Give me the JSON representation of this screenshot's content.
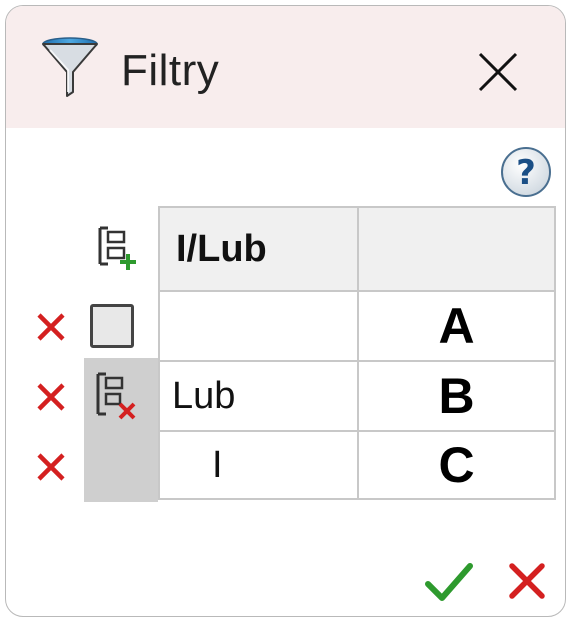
{
  "window": {
    "title": "Filtry"
  },
  "table": {
    "header": [
      "I/Lub",
      ""
    ],
    "rows": [
      {
        "cell": "",
        "label": "A"
      },
      {
        "cell": "Lub",
        "label": "B"
      },
      {
        "cell": "I",
        "label": "C"
      }
    ]
  },
  "icons": {
    "title": "funnel-icon",
    "close": "close-icon",
    "help": "help-icon",
    "add_group": "add-group-icon",
    "remove_group": "remove-group-icon",
    "delete_row": "delete-row-icon",
    "ok": "checkmark-icon",
    "cancel": "cancel-icon"
  },
  "colors": {
    "delete": "#d42020",
    "ok": "#2e9a2e",
    "titlebar_bg": "#f8eded",
    "group_bg": "#cfcfcf"
  }
}
